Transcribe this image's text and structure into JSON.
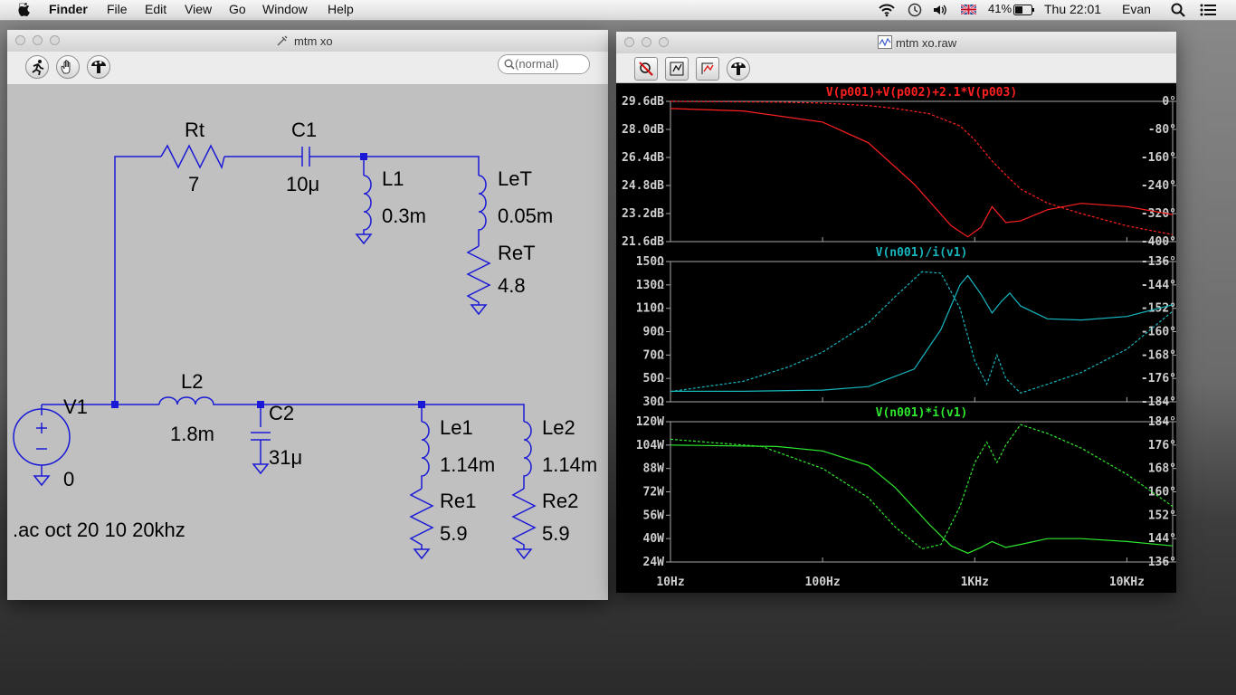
{
  "menubar": {
    "app": "Finder",
    "items": [
      "File",
      "Edit",
      "View",
      "Go",
      "Window",
      "Help"
    ],
    "battery": "41%",
    "clock": "Thu 22:01",
    "user": "Evan"
  },
  "schematic_window": {
    "title": "mtm xo",
    "search_placeholder": "(normal)",
    "components": {
      "rt_name": "Rt",
      "rt_value": "7",
      "c1_name": "C1",
      "c1_value": "10μ",
      "l1_name": "L1",
      "l1_value": "0.3m",
      "let_name": "LeT",
      "let_value": "0.05m",
      "ret_name": "ReT",
      "ret_value": "4.8",
      "v1_name": "V1",
      "v1_value": "0",
      "l2_name": "L2",
      "l2_value": "1.8m",
      "c2_name": "C2",
      "c2_value": "31μ",
      "le1_name": "Le1",
      "le1_value": "1.14m",
      "re1_name": "Re1",
      "re1_value": "5.9",
      "le2_name": "Le2",
      "le2_value": "1.14m",
      "re2_name": "Re2",
      "re2_value": "5.9"
    },
    "directive": ".ac oct 20 10 20khz"
  },
  "plot_window": {
    "title": "mtm xo.raw"
  },
  "colors": {
    "wire": "#1a1ad6",
    "plot1": "#ff2020",
    "plot2": "#17b6bf",
    "plot3": "#2ee82e",
    "plot_bg": "#000000"
  },
  "chart_data": [
    {
      "type": "line",
      "title": "V(p001)+V(p002)+2.1*V(p003)",
      "x_scale": "log",
      "x_ticks": [
        "10Hz",
        "100Hz",
        "1KHz",
        "10KHz"
      ],
      "left_ticks": [
        "29.6dB",
        "28.0dB",
        "26.4dB",
        "24.8dB",
        "23.2dB",
        "21.6dB"
      ],
      "right_ticks": [
        "0°",
        "-80°",
        "-160°",
        "-240°",
        "-320°",
        "-400°"
      ],
      "ylim": [
        21.6,
        30.4
      ],
      "y2lim": [
        -400,
        0
      ],
      "series": [
        {
          "style": "solid",
          "axis": "left",
          "x": [
            10,
            30,
            100,
            200,
            400,
            700,
            900,
            1100,
            1300,
            1600,
            2000,
            3000,
            5000,
            10000,
            20000
          ],
          "y": [
            29.95,
            29.8,
            29.1,
            27.8,
            25.2,
            22.6,
            21.9,
            22.5,
            23.8,
            22.8,
            22.9,
            23.6,
            24.0,
            23.8,
            23.3
          ]
        },
        {
          "style": "dashed",
          "axis": "right",
          "x": [
            10,
            50,
            100,
            200,
            300,
            500,
            800,
            1000,
            1300,
            1600,
            2000,
            3000,
            5000,
            10000,
            20000
          ],
          "y": [
            0,
            -2,
            -5,
            -12,
            -20,
            -35,
            -70,
            -110,
            -170,
            -210,
            -250,
            -290,
            -320,
            -355,
            -380
          ]
        }
      ]
    },
    {
      "type": "line",
      "title": "V(n001)/i(v1)",
      "x_scale": "log",
      "x_ticks": [
        "10Hz",
        "100Hz",
        "1KHz",
        "10KHz"
      ],
      "left_ticks": [
        "150Ω",
        "130Ω",
        "110Ω",
        "90Ω",
        "70Ω",
        "50Ω",
        "30Ω"
      ],
      "right_ticks": [
        "-136°",
        "-144°",
        "-152°",
        "-160°",
        "-168°",
        "-176°",
        "-184°"
      ],
      "ylim": [
        30,
        150
      ],
      "y2lim": [
        -184,
        -136
      ],
      "series": [
        {
          "style": "solid",
          "axis": "left",
          "x": [
            10,
            30,
            100,
            200,
            400,
            600,
            800,
            900,
            1100,
            1300,
            1500,
            1700,
            2000,
            3000,
            5000,
            10000,
            20000
          ],
          "y": [
            39,
            39,
            40,
            43,
            58,
            92,
            130,
            138,
            122,
            106,
            116,
            123,
            112,
            101,
            100,
            103,
            113
          ]
        },
        {
          "style": "dashed",
          "axis": "right",
          "x": [
            10,
            30,
            60,
            100,
            200,
            300,
            450,
            600,
            800,
            1000,
            1200,
            1400,
            1600,
            2000,
            3000,
            5000,
            10000,
            20000
          ],
          "y": [
            -180.5,
            -177,
            -172,
            -167,
            -157,
            -148,
            -139.5,
            -140,
            -152,
            -170,
            -178,
            -168,
            -176,
            -181,
            -178,
            -174,
            -166,
            -153
          ]
        }
      ]
    },
    {
      "type": "line",
      "title": "V(n001)*i(v1)",
      "x_scale": "log",
      "x_ticks": [
        "10Hz",
        "100Hz",
        "1KHz",
        "10KHz"
      ],
      "left_ticks": [
        "120W",
        "104W",
        "88W",
        "72W",
        "56W",
        "40W",
        "24W"
      ],
      "right_ticks": [
        "184°",
        "176°",
        "168°",
        "160°",
        "152°",
        "144°",
        "136°"
      ],
      "ylim": [
        24,
        120
      ],
      "y2lim": [
        136,
        184
      ],
      "series": [
        {
          "style": "solid",
          "axis": "left",
          "x": [
            10,
            50,
            100,
            200,
            300,
            500,
            700,
            900,
            1100,
            1300,
            1600,
            2000,
            3000,
            5000,
            10000,
            20000
          ],
          "y": [
            104,
            103,
            100,
            90,
            75,
            50,
            35,
            30,
            34,
            38,
            34,
            36,
            40,
            40,
            38,
            35
          ]
        },
        {
          "style": "dashed",
          "axis": "right",
          "x": [
            10,
            40,
            100,
            200,
            300,
            450,
            600,
            800,
            1000,
            1200,
            1400,
            1600,
            2000,
            3000,
            5000,
            10000,
            20000
          ],
          "y": [
            178,
            175.5,
            168,
            158,
            148,
            140.5,
            142,
            155,
            170,
            177,
            170,
            176,
            183,
            180,
            175,
            166,
            155
          ]
        }
      ]
    }
  ]
}
